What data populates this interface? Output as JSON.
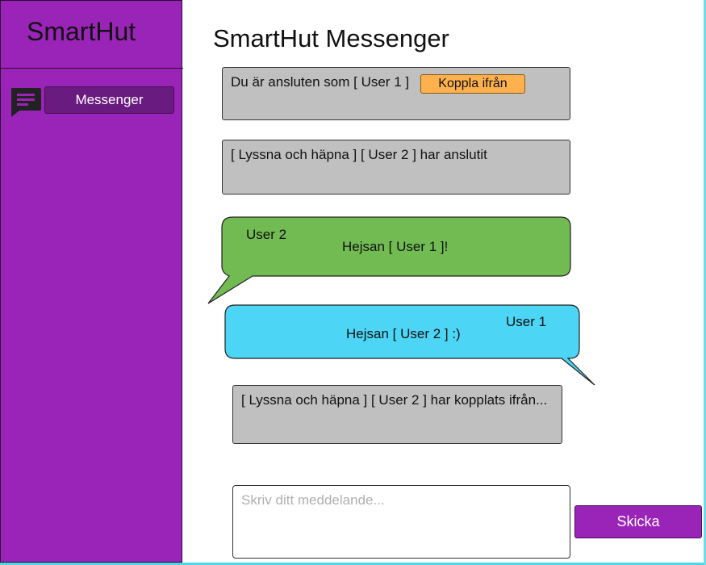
{
  "sidebar": {
    "brand": "SmartHut",
    "items": [
      {
        "label": "Messenger",
        "icon": "chat-icon"
      }
    ]
  },
  "main": {
    "title": "SmartHut Messenger",
    "status": {
      "connected_text": "Du är ansluten som [ User 1 ]",
      "disconnect_label": "Koppla ifrån"
    },
    "events": [
      "[ Lyssna och häpna ] [ User 2 ] har anslutit",
      "[ Lyssna och häpna ] [ User 2 ] har kopplats ifrån..."
    ],
    "messages": [
      {
        "sender": "User 2",
        "text": "Hejsan [ User 1 ]!",
        "color": "#72bb53"
      },
      {
        "sender": "User 1",
        "text": "Hejsan [ User 2 ] :)",
        "color": "#4cd5f5"
      }
    ],
    "composer": {
      "placeholder": "Skriv ditt meddelande...",
      "value": "",
      "send_label": "Skicka"
    }
  },
  "colors": {
    "sidebar_bg": "#9b24b8",
    "nav_active": "#6a1b80",
    "system_bg": "#c0c0c0",
    "accent_orange": "#ffb14f"
  }
}
